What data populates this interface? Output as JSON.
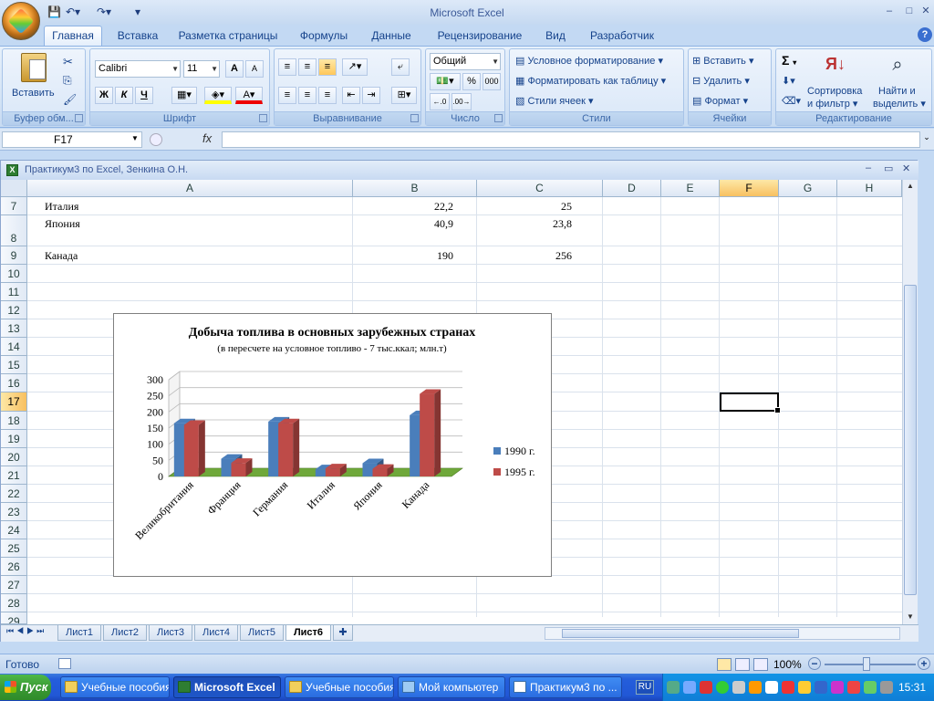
{
  "app_title": "Microsoft Excel",
  "tabs": [
    "Главная",
    "Вставка",
    "Разметка страницы",
    "Формулы",
    "Данные",
    "Рецензирование",
    "Вид",
    "Разработчик"
  ],
  "ribbon": {
    "clipboard": {
      "label": "Буфер обм...",
      "paste": "Вставить"
    },
    "font": {
      "label": "Шрифт",
      "name": "Calibri",
      "size": "11",
      "bold": "Ж",
      "italic": "К",
      "underline": "Ч",
      "grow": "A",
      "shrink": "A",
      "color_a": "A"
    },
    "alignment": {
      "label": "Выравнивание"
    },
    "number": {
      "label": "Число",
      "format": "Общий",
      "percent": "%",
      "thousands": "000"
    },
    "styles": {
      "label": "Стили",
      "cond": "Условное форматирование",
      "table": "Форматировать как таблицу",
      "cell": "Стили ячеек"
    },
    "cells": {
      "label": "Ячейки",
      "insert": "Вставить",
      "delete": "Удалить",
      "format": "Формат"
    },
    "editing": {
      "label": "Редактирование",
      "sigma": "Σ",
      "sort1": "Сортировка",
      "sort2": "и фильтр",
      "find1": "Найти и",
      "find2": "выделить"
    }
  },
  "formula_bar": {
    "namebox": "F17",
    "fx": "fx",
    "value": ""
  },
  "workbook_title": "Практикум3 по Excel, Зенкина О.Н.",
  "columns": [
    "A",
    "B",
    "C",
    "D",
    "E",
    "F",
    "G",
    "H"
  ],
  "rows": [
    "7",
    "8",
    "9",
    "10",
    "11",
    "12",
    "13",
    "14",
    "15",
    "16",
    "17",
    "18",
    "19",
    "20",
    "21",
    "22",
    "23",
    "24",
    "25",
    "26",
    "27",
    "28",
    "29"
  ],
  "cells": {
    "r7": {
      "a": "Италия",
      "b": "22,2",
      "c": "25"
    },
    "r8": {
      "a": "Япония",
      "b": "40,9",
      "c": "23,8"
    },
    "r9": {
      "a": "Канада",
      "b": "190",
      "c": "256"
    }
  },
  "chart_data": {
    "type": "bar",
    "title": "Добыча топлива в основных зарубежных странах",
    "subtitle": "(в пересчете на условное топливо - 7 тыс.ккал; млн.т)",
    "categories": [
      "Великобритания",
      "Франция",
      "Германия",
      "Италия",
      "Япония",
      "Канада"
    ],
    "series": [
      {
        "name": "1990 г.",
        "values": [
          165,
          55,
          170,
          22.2,
          40.9,
          190
        ],
        "color": "#4a7ebb"
      },
      {
        "name": "1995 г.",
        "values": [
          160,
          42,
          165,
          25,
          23.8,
          256
        ],
        "color": "#be4b48"
      }
    ],
    "yticks": [
      "0",
      "50",
      "100",
      "150",
      "200",
      "250",
      "300"
    ],
    "ylim": [
      0,
      300
    ],
    "legend": "right"
  },
  "sheet_tabs": [
    "Лист1",
    "Лист2",
    "Лист3",
    "Лист4",
    "Лист5",
    "Лист6"
  ],
  "active_sheet": "Лист6",
  "status": {
    "ready": "Готово",
    "zoom": "100%"
  },
  "taskbar": {
    "start": "Пуск",
    "items": [
      "Учебные пособия",
      "Microsoft Excel",
      "Учебные пособия",
      "Мой компьютер",
      "Практикум3 по ..."
    ],
    "lang": "RU",
    "clock": "15:31"
  }
}
